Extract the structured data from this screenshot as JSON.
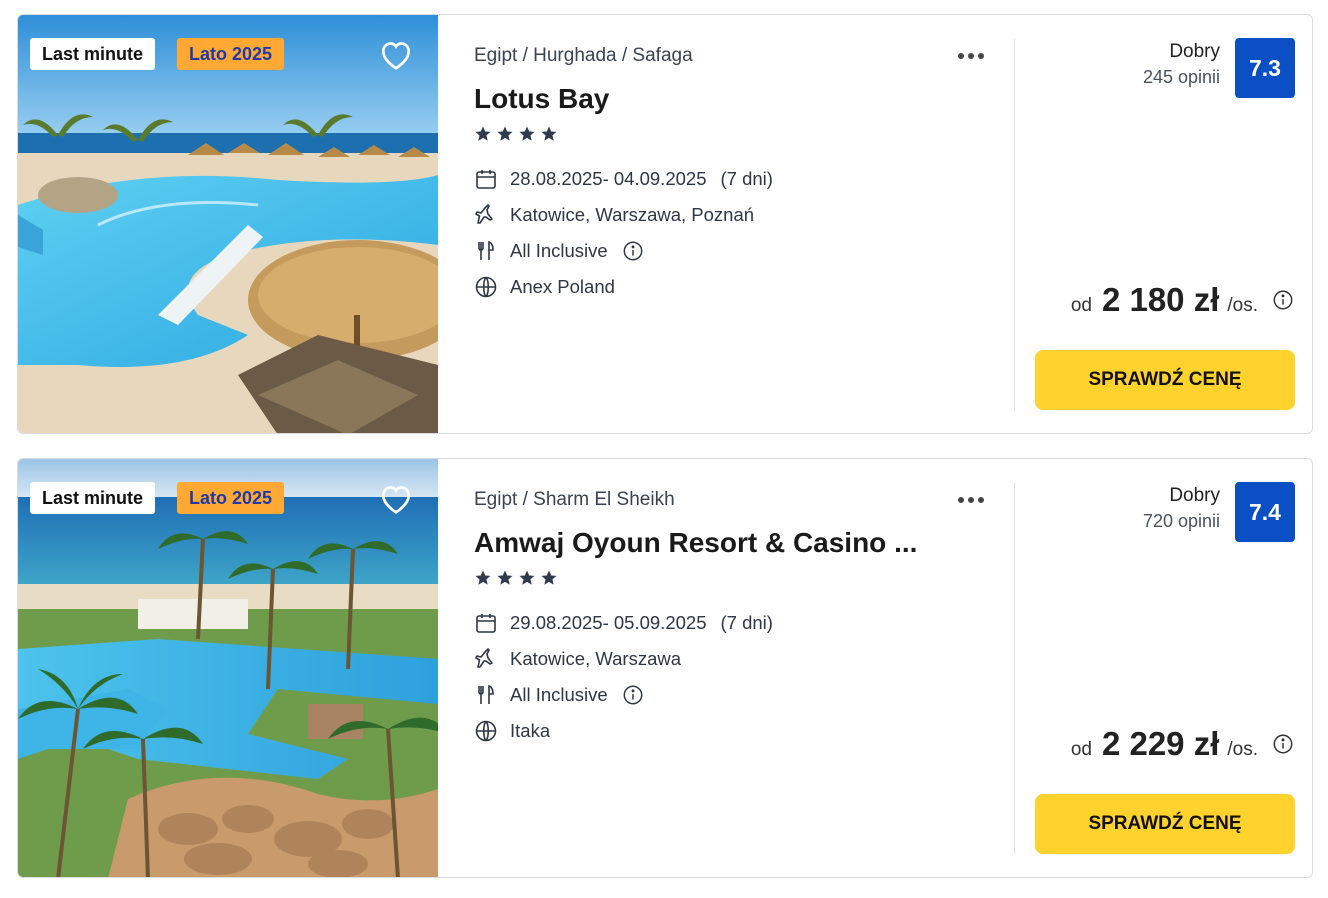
{
  "offers": [
    {
      "badges": {
        "last_minute": "Last minute",
        "season": "Lato 2025"
      },
      "location": "Egipt / Hurghada / Safaga",
      "hotel_name": "Lotus Bay",
      "stars": 4,
      "dates": "28.08.2025- 04.09.2025",
      "duration": "(7 dni)",
      "departures": "Katowice, Warszawa, Poznań",
      "board": "All Inclusive",
      "operator": "Anex Poland",
      "rating_word": "Dobry",
      "reviews": "245 opinii",
      "score": "7.3",
      "price_prefix": "od",
      "price": "2 180 zł",
      "price_unit": "/os.",
      "cta": "SPRAWDŹ CENĘ"
    },
    {
      "badges": {
        "last_minute": "Last minute",
        "season": "Lato 2025"
      },
      "location": "Egipt / Sharm El Sheikh",
      "hotel_name": "Amwaj Oyoun Resort & Casino ...",
      "stars": 4,
      "dates": "29.08.2025- 05.09.2025",
      "duration": "(7 dni)",
      "departures": "Katowice, Warszawa",
      "board": "All Inclusive",
      "operator": "Itaka",
      "rating_word": "Dobry",
      "reviews": "720 opinii",
      "score": "7.4",
      "price_prefix": "od",
      "price": "2 229 zł",
      "price_unit": "/os.",
      "cta": "SPRAWDŹ CENĘ"
    }
  ],
  "icons": {
    "favorite": "heart-outline-icon",
    "more": "more-dots-icon",
    "date": "calendar-icon",
    "departure": "plane-icon",
    "board": "cutlery-icon",
    "operator": "globe-icon",
    "info": "info-icon",
    "star": "star-icon"
  },
  "colors": {
    "season_badge_bg": "#ffa934",
    "season_badge_text": "#1f3aa8",
    "score_bg": "#0b4fc4",
    "cta_bg": "#ffd22e",
    "stars": "#2d3a4f"
  }
}
